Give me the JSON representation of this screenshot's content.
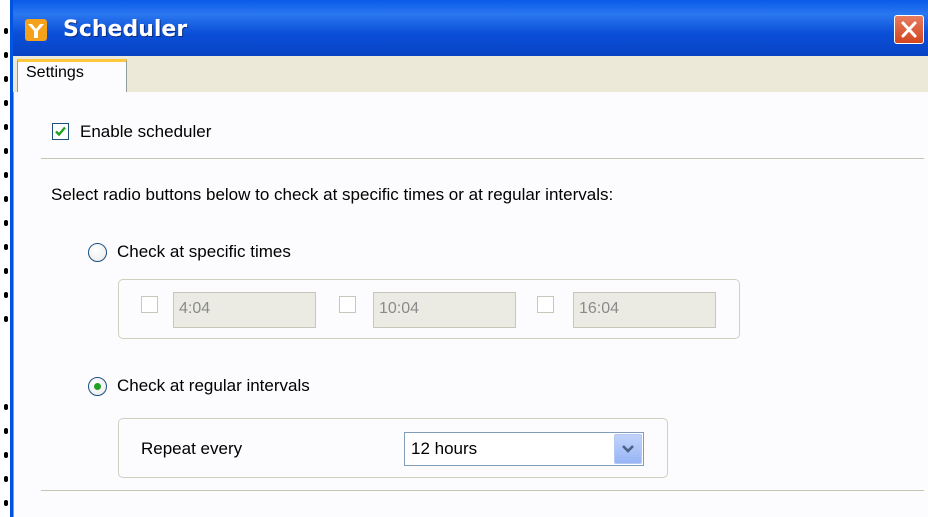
{
  "window": {
    "title": "Scheduler",
    "accent_color": "#0054e3",
    "close_color": "#d2461f"
  },
  "tabs": [
    {
      "label": "Settings",
      "active": true
    }
  ],
  "settings": {
    "enable_scheduler_label": "Enable scheduler",
    "enable_scheduler_checked": true,
    "instructions": "Select radio buttons below to check at specific times or at regular intervals:",
    "specific_times": {
      "label": "Check at specific times",
      "selected": false,
      "times": [
        {
          "value": "4:04",
          "checked": false,
          "enabled": false
        },
        {
          "value": "10:04",
          "checked": false,
          "enabled": false
        },
        {
          "value": "16:04",
          "checked": false,
          "enabled": false
        }
      ]
    },
    "regular_intervals": {
      "label": "Check at regular intervals",
      "selected": true,
      "repeat_label": "Repeat every",
      "repeat_value": "12 hours"
    }
  },
  "icons": {
    "app": "scheduler-app-icon",
    "close": "close-icon",
    "dropdown": "chevron-down-icon",
    "check": "checkmark-icon"
  }
}
